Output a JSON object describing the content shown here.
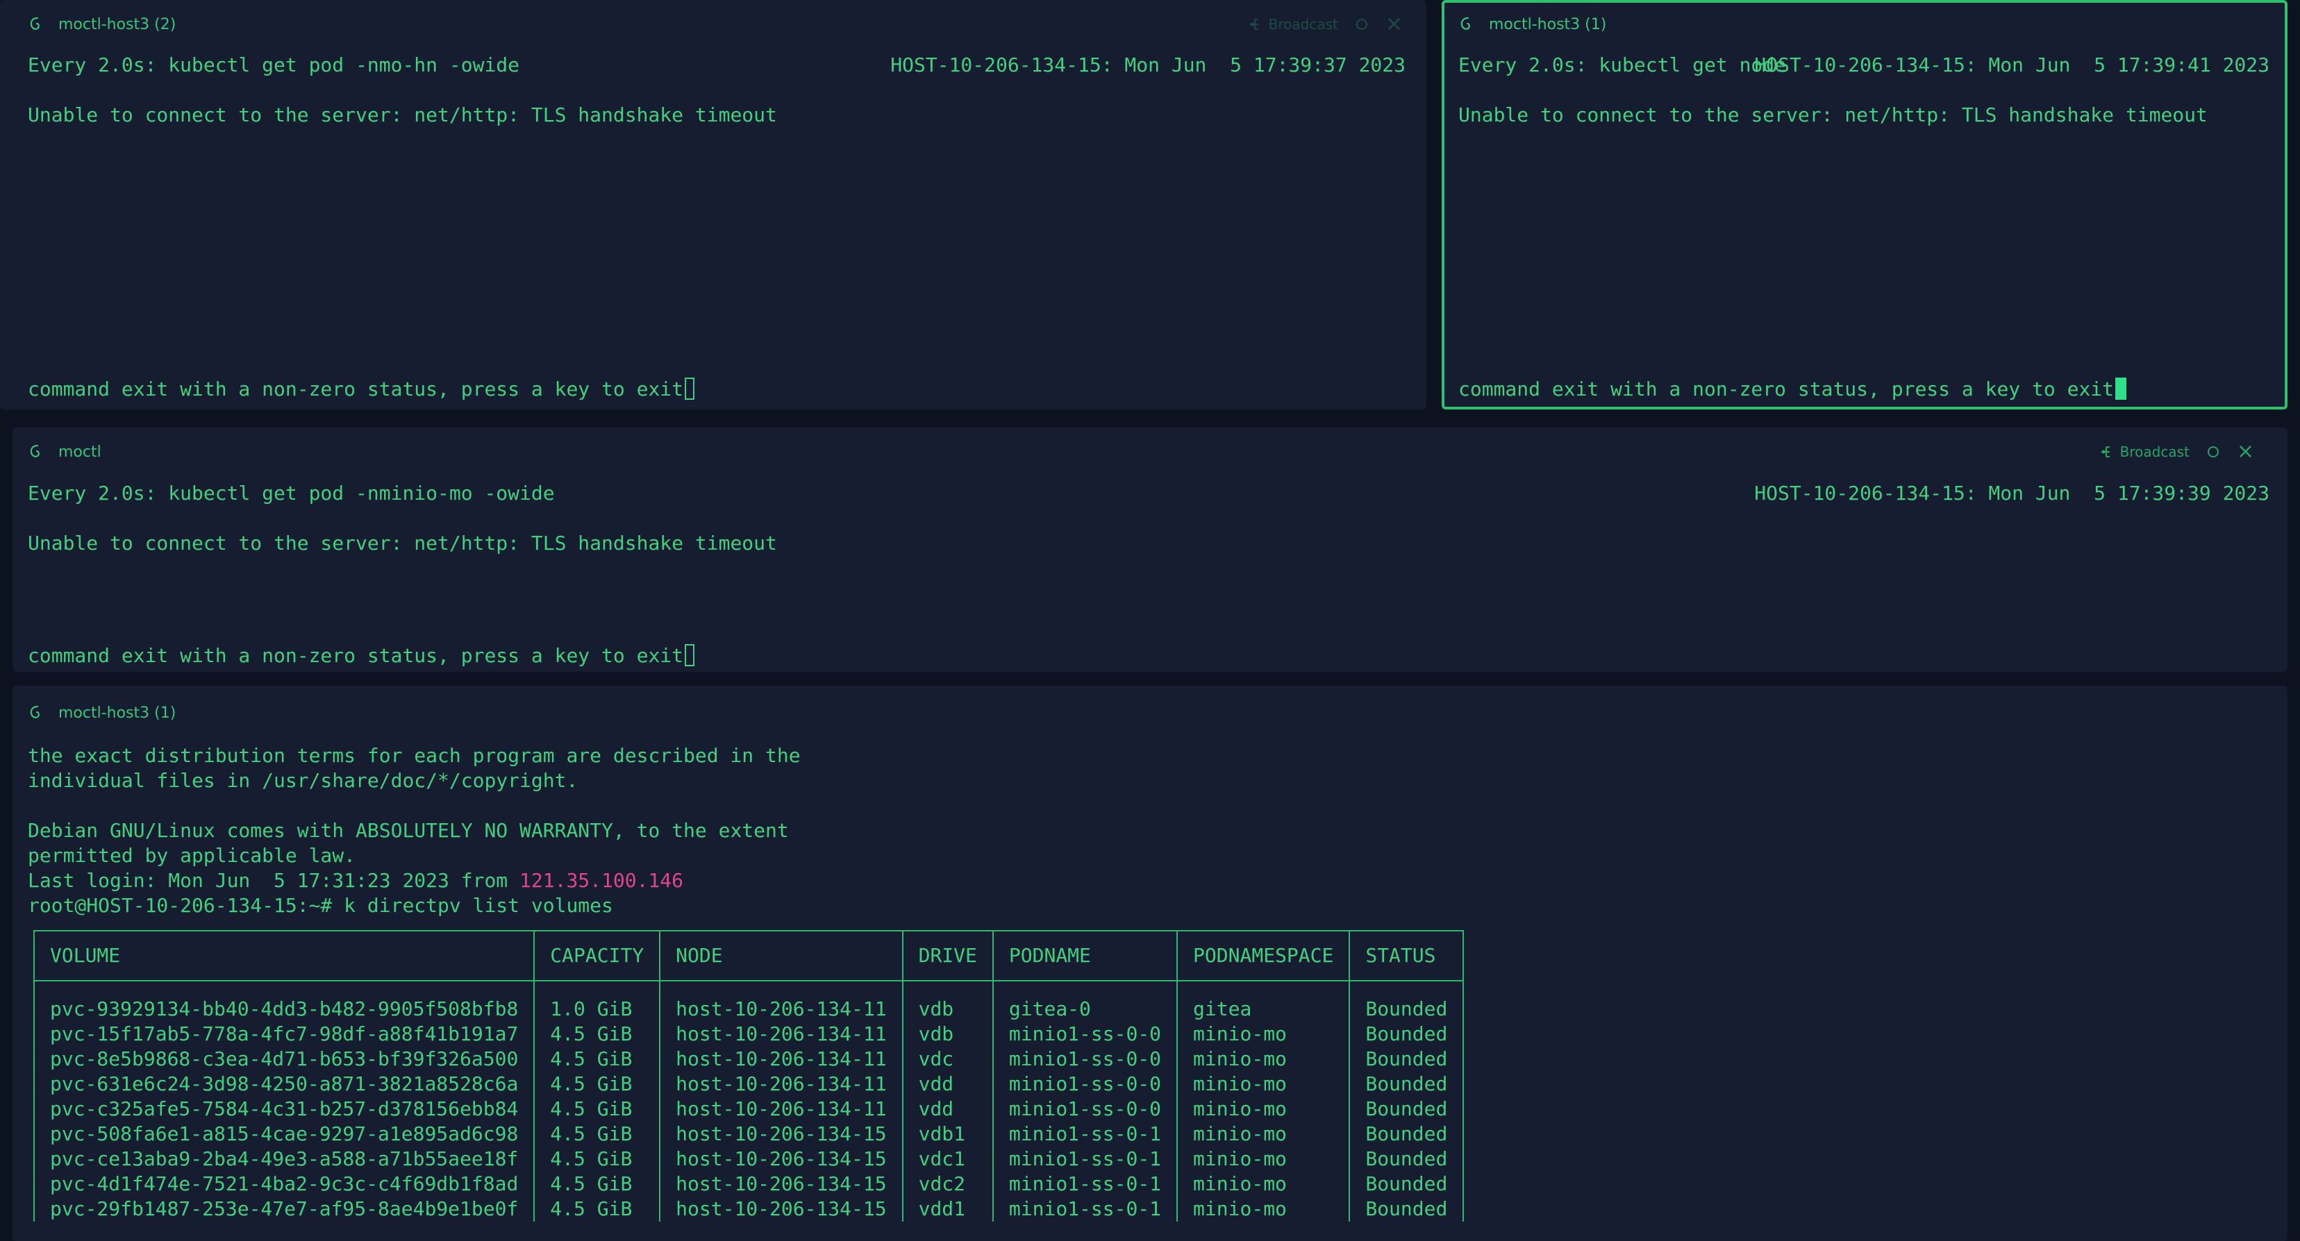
{
  "panes": {
    "top_left": {
      "title": "moctl-host3 (2)",
      "broadcast_label": "Broadcast",
      "command": "Every 2.0s: kubectl get pod -nmo-hn -owide",
      "host_time": "HOST-10-206-134-15: Mon Jun  5 17:39:37 2023",
      "error": "Unable to connect to the server: net/http: TLS handshake timeout",
      "exit_message": "command exit with a non-zero status, press a key to exit"
    },
    "top_right": {
      "title": "moctl-host3 (1)",
      "command": "Every 2.0s: kubectl get node",
      "host_time": "HOST-10-206-134-15: Mon Jun  5 17:39:41 2023",
      "error": "Unable to connect to the server: net/http: TLS handshake timeout",
      "exit_message": "command exit with a non-zero status, press a key to exit"
    },
    "middle": {
      "title": "moctl",
      "broadcast_label": "Broadcast",
      "command": "Every 2.0s: kubectl get pod -nminio-mo -owide",
      "host_time": "HOST-10-206-134-15: Mon Jun  5 17:39:39 2023",
      "error": "Unable to connect to the server: net/http: TLS handshake timeout",
      "exit_message": "command exit with a non-zero status, press a key to exit"
    },
    "bottom": {
      "title": "moctl-host3 (1)",
      "lines": [
        "the exact distribution terms for each program are described in the",
        "individual files in /usr/share/doc/*/copyright.",
        "",
        "Debian GNU/Linux comes with ABSOLUTELY NO WARRANTY, to the extent",
        "permitted by applicable law."
      ],
      "last_login_prefix": "Last login: Mon Jun  5 17:31:23 2023 from ",
      "last_login_ip": "121.35.100.146",
      "prompt": "root@HOST-10-206-134-15:~# k directpv list volumes",
      "table": {
        "headers": [
          "VOLUME",
          "CAPACITY",
          "NODE",
          "DRIVE",
          "PODNAME",
          "PODNAMESPACE",
          "STATUS"
        ],
        "rows": [
          [
            "pvc-93929134-bb40-4dd3-b482-9905f508bfb8",
            "1.0 GiB",
            "host-10-206-134-11",
            "vdb",
            "gitea-0",
            "gitea",
            "Bounded"
          ],
          [
            "pvc-15f17ab5-778a-4fc7-98df-a88f41b191a7",
            "4.5 GiB",
            "host-10-206-134-11",
            "vdb",
            "minio1-ss-0-0",
            "minio-mo",
            "Bounded"
          ],
          [
            "pvc-8e5b9868-c3ea-4d71-b653-bf39f326a500",
            "4.5 GiB",
            "host-10-206-134-11",
            "vdc",
            "minio1-ss-0-0",
            "minio-mo",
            "Bounded"
          ],
          [
            "pvc-631e6c24-3d98-4250-a871-3821a8528c6a",
            "4.5 GiB",
            "host-10-206-134-11",
            "vdd",
            "minio1-ss-0-0",
            "minio-mo",
            "Bounded"
          ],
          [
            "pvc-c325afe5-7584-4c31-b257-d378156ebb84",
            "4.5 GiB",
            "host-10-206-134-11",
            "vdd",
            "minio1-ss-0-0",
            "minio-mo",
            "Bounded"
          ],
          [
            "pvc-508fa6e1-a815-4cae-9297-a1e895ad6c98",
            "4.5 GiB",
            "host-10-206-134-15",
            "vdb1",
            "minio1-ss-0-1",
            "minio-mo",
            "Bounded"
          ],
          [
            "pvc-ce13aba9-2ba4-49e3-a588-a71b55aee18f",
            "4.5 GiB",
            "host-10-206-134-15",
            "vdc1",
            "minio1-ss-0-1",
            "minio-mo",
            "Bounded"
          ],
          [
            "pvc-4d1f474e-7521-4ba2-9c3c-c4f69db1f8ad",
            "4.5 GiB",
            "host-10-206-134-15",
            "vdc2",
            "minio1-ss-0-1",
            "minio-mo",
            "Bounded"
          ],
          [
            "pvc-29fb1487-253e-47e7-af95-8ae4b9e1be0f",
            "4.5 GiB",
            "host-10-206-134-15",
            "vdd1",
            "minio1-ss-0-1",
            "minio-mo",
            "Bounded"
          ]
        ]
      }
    }
  },
  "icons": {
    "os": "debian-swirl-icon",
    "broadcast": "broadcast-icon",
    "close": "close-icon"
  },
  "colors": {
    "background": "#0d1220",
    "pane": "#171d30",
    "text": "#3fd17f",
    "active_border": "#2fc06f",
    "ip": "#e0468f"
  }
}
